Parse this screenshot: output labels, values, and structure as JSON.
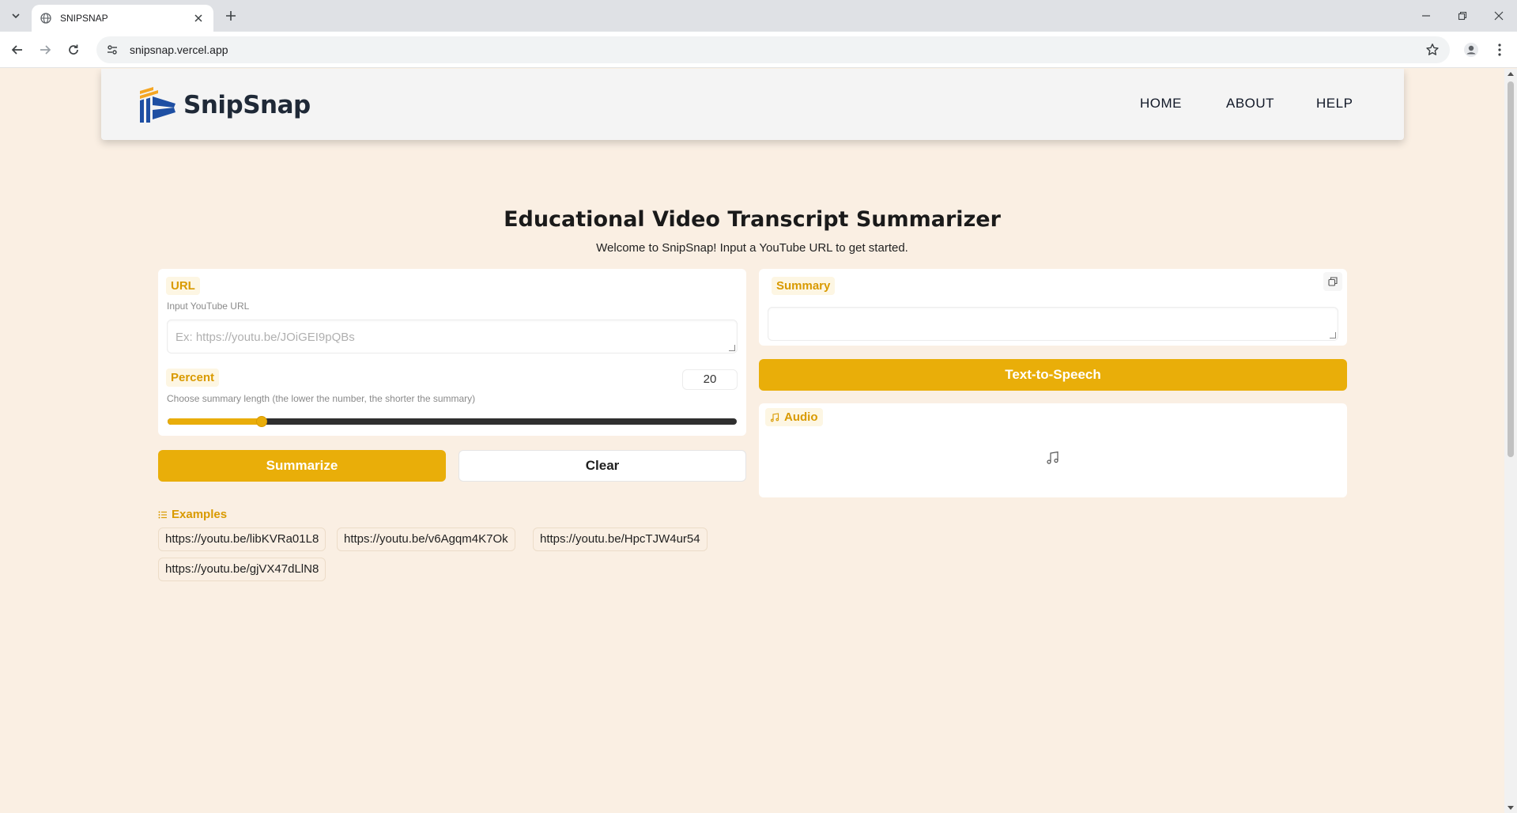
{
  "browser": {
    "tab_title": "SNIPSNAP",
    "url": "snipsnap.vercel.app"
  },
  "header": {
    "logo_text": "SnipSnap",
    "nav": [
      "HOME",
      "ABOUT",
      "HELP"
    ]
  },
  "main": {
    "title": "Educational Video Transcript Summarizer",
    "subtitle": "Welcome to SnipSnap! Input a YouTube URL to get started."
  },
  "url_panel": {
    "label": "URL",
    "hint": "Input YouTube URL",
    "placeholder": "Ex: https://youtu.be/JOiGEI9pQBs",
    "value": ""
  },
  "percent_panel": {
    "label": "Percent",
    "hint": "Choose summary length (the lower the number, the shorter the summary)",
    "value": "20",
    "slider_fraction": 0.165
  },
  "buttons": {
    "summarize": "Summarize",
    "clear": "Clear",
    "tts": "Text-to-Speech"
  },
  "summary_panel": {
    "label": "Summary",
    "value": ""
  },
  "audio_panel": {
    "label": "Audio"
  },
  "examples": {
    "label": "Examples",
    "items": [
      "https://youtu.be/libKVRa01L8",
      "https://youtu.be/v6Agqm4K7Ok",
      "https://youtu.be/HpcTJW4ur54",
      "https://youtu.be/gjVX47dLlN8"
    ]
  },
  "colors": {
    "accent": "#e9ae09",
    "page_bg": "#faefe3",
    "label_text": "#d99a00"
  }
}
